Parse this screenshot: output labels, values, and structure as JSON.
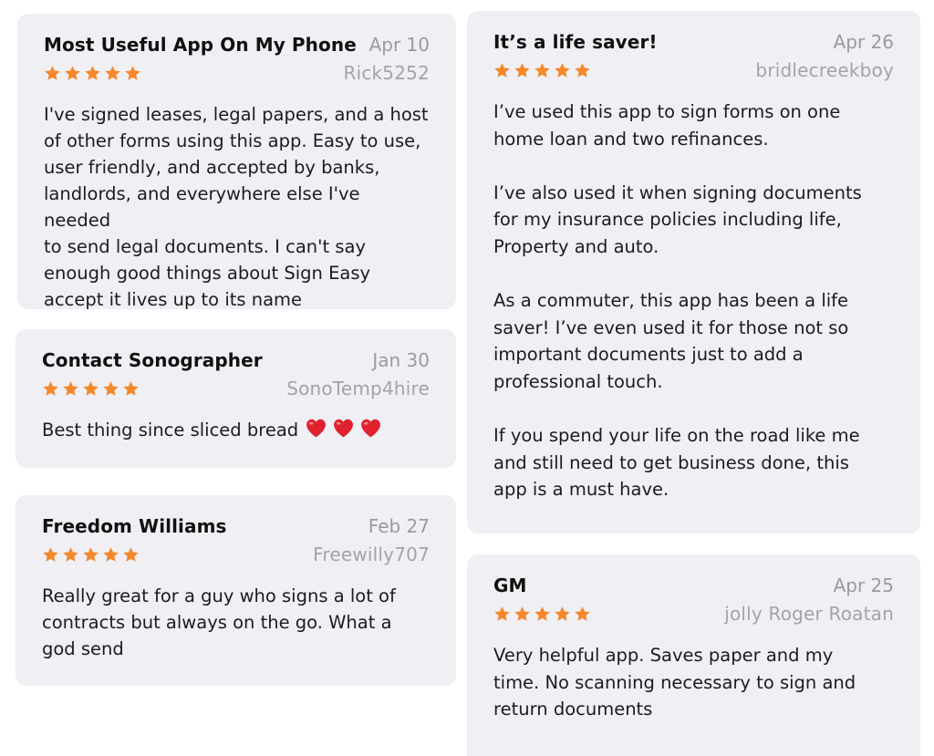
{
  "reviews": [
    {
      "title": "Most Useful App On My Phone",
      "date": "Apr 10",
      "author": "Rick5252",
      "rating": 5,
      "body": "I've signed leases, legal papers, and a host\nof other forms using this app. Easy to use,\nuser friendly, and accepted by banks,\nlandlords, and everywhere else I've needed\nto send legal documents. I can't say\nenough good things about Sign Easy\naccept it lives up to its name"
    },
    {
      "title": "Contact Sonographer",
      "date": "Jan 30",
      "author": "SonoTemp4hire",
      "rating": 5,
      "body": "Best thing since sliced bread",
      "emoji": [
        "heart-emoji",
        "heart-emoji",
        "heart-emoji"
      ]
    },
    {
      "title": "Freedom Williams",
      "date": "Feb 27",
      "author": "Freewilly707",
      "rating": 5,
      "body": "Really great for a guy who signs a lot of\ncontracts but always on the go.  What a\ngod send"
    },
    {
      "title": "It’s a life saver!",
      "date": "Apr 26",
      "author": "bridlecreekboy",
      "rating": 5,
      "body": "I’ve used this app to sign forms on one\nhome loan and two refinances.\n\nI’ve also used it when signing documents\nfor my insurance policies including life,\nProperty and auto.\n\nAs a commuter, this app has been a life\nsaver!  I’ve even used it for those not so\nimportant documents just to add a\nprofessional touch.\n\nIf you spend your life on the road like me\nand still need to get business done, this\napp is a must have."
    },
    {
      "title": "GM",
      "date": "Apr 25",
      "author": "jolly Roger Roatan",
      "rating": 5,
      "body": "Very helpful app.  Saves paper and my\ntime.  No scanning necessary to sign and\nreturn documents"
    }
  ],
  "colors": {
    "star": "#f5882a",
    "card": "#efeff4",
    "heart": "#e0222e"
  }
}
